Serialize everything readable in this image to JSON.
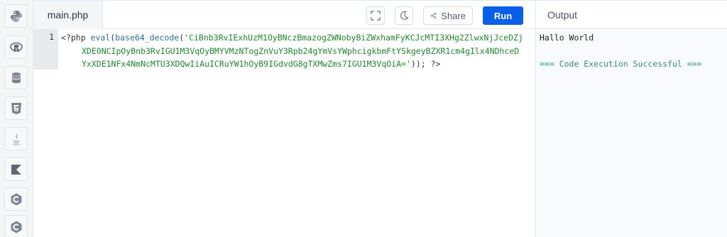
{
  "languages": [
    {
      "name": "python-icon"
    },
    {
      "name": "r-icon"
    },
    {
      "name": "sql-icon"
    },
    {
      "name": "html5-icon"
    },
    {
      "name": "java-icon"
    },
    {
      "name": "kotlin-icon"
    },
    {
      "name": "c-icon"
    },
    {
      "name": "cpp-icon"
    }
  ],
  "editor": {
    "file_tab": "main.php",
    "line_number": "1",
    "code": {
      "open_tag": "<?php ",
      "eval": "eval",
      "paren_open": "(",
      "decode": "base64_decode",
      "paren_open2": "(",
      "str_line1": "'CiBnb3RvIExhUzM1OyBNczBmazogZWNobyBiZWxhamFyKCJcMTI3XHg2ZlwxNjJceDZj",
      "str_line2": "XDE0NCIpOyBnb3RvIGU1M3VqOyBMYVMzNTogZnVuY3Rpb24gYmVsYWphcigkbmFtYSkgeyBZXR1cm4gIlx4NDhceD",
      "str_line3": "YxXDE1NFx4NmNcMTU3XDQwIiAuICRuYW1hOyB9IGdvdG8gTXMwZms7IGU1M3VqOiA='",
      "close": ")); ?>"
    },
    "toolbar": {
      "fullscreen_icon": "fullscreen-icon",
      "theme_icon": "moon-icon",
      "share_label": "Share",
      "run_label": "Run"
    }
  },
  "output": {
    "title": "Output",
    "lines": [
      "Hallo World",
      "",
      "=== Code Execution Successful ==="
    ]
  },
  "colors": {
    "run_button": "#0a5fe8",
    "string": "#1f8a2e",
    "function": "#2a6f97",
    "success": "#2f8f82"
  }
}
